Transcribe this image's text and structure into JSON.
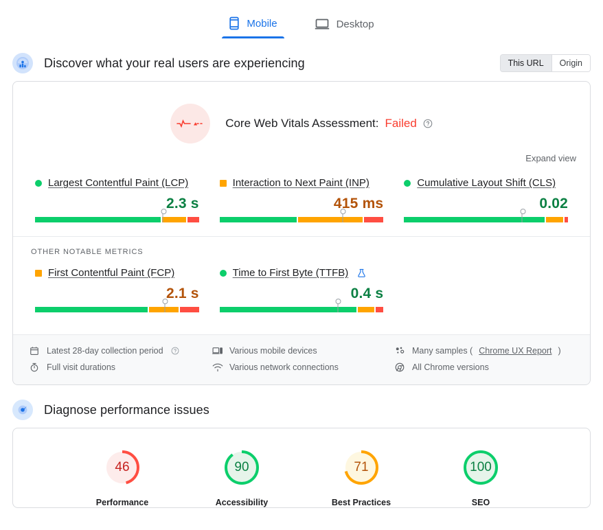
{
  "device_tabs": [
    {
      "id": "mobile",
      "label": "Mobile",
      "icon": "phone-icon",
      "active": true
    },
    {
      "id": "desktop",
      "label": "Desktop",
      "icon": "laptop-icon",
      "active": false
    }
  ],
  "field_section": {
    "title": "Discover what your real users are experiencing",
    "icon": "users-chart-icon",
    "scope_toggle": {
      "options": [
        {
          "id": "this-url",
          "label": "This URL",
          "selected": true
        },
        {
          "id": "origin",
          "label": "Origin",
          "selected": false
        }
      ]
    },
    "assessment": {
      "icon": "pulse-icon",
      "label": "Core Web Vitals Assessment:",
      "status": "Failed",
      "status_color": "#f93c2e",
      "help_icon": "help-circle-icon"
    },
    "expand_view": "Expand view",
    "other_metrics_label": "OTHER NOTABLE METRICS",
    "core_metrics": [
      {
        "id": "lcp",
        "name": "Largest Contentful Paint (LCP)",
        "rating": "good",
        "value": "2.3 s",
        "distribution": {
          "good": 78,
          "needs_improvement": 15,
          "poor": 7
        },
        "marker_percent": 78
      },
      {
        "id": "inp",
        "name": "Interaction to Next Paint (INP)",
        "rating": "average",
        "value": "415 ms",
        "distribution": {
          "good": 48,
          "needs_improvement": 40,
          "poor": 12
        },
        "marker_percent": 75
      },
      {
        "id": "cls",
        "name": "Cumulative Layout Shift (CLS)",
        "rating": "good",
        "value": "0.02",
        "distribution": {
          "good": 87,
          "needs_improvement": 11,
          "poor": 2
        },
        "marker_percent": 72
      }
    ],
    "other_notable_metrics": [
      {
        "id": "fcp",
        "name": "First Contentful Paint (FCP)",
        "rating": "average",
        "value": "2.1 s",
        "distribution": {
          "good": 70,
          "needs_improvement": 18,
          "poor": 12
        },
        "marker_percent": 79,
        "experimental": false
      },
      {
        "id": "ttfb",
        "name": "Time to First Byte (TTFB)",
        "rating": "good",
        "value": "0.4 s",
        "distribution": {
          "good": 85,
          "needs_improvement": 10,
          "poor": 5
        },
        "marker_percent": 72,
        "experimental": true,
        "experimental_icon": "flask-icon"
      }
    ],
    "meta_items": [
      {
        "id": "collection-period",
        "icon": "calendar-icon",
        "text": "Latest 28-day collection period",
        "help": true
      },
      {
        "id": "mobile-devices",
        "icon": "devices-icon",
        "text": "Various mobile devices",
        "help": false
      },
      {
        "id": "many-samples",
        "icon": "samples-icon",
        "text": "Many samples (",
        "link": "Chrome UX Report",
        "text_after": ")",
        "help": false
      },
      {
        "id": "visit-durations",
        "icon": "stopwatch-icon",
        "text": "Full visit durations",
        "help": false
      },
      {
        "id": "network-connections",
        "icon": "wifi-icon",
        "text": "Various network connections",
        "help": false
      },
      {
        "id": "chrome-versions",
        "icon": "chrome-icon",
        "text": "All Chrome versions",
        "help": false
      }
    ]
  },
  "lab_section": {
    "title": "Diagnose performance issues",
    "icon": "target-icon",
    "scores": [
      {
        "id": "performance",
        "label": "Performance",
        "value": 46,
        "rating": "poor",
        "color": "#ff4e42",
        "bg": "#fdeceb",
        "text_color": "#c5221f"
      },
      {
        "id": "accessibility",
        "label": "Accessibility",
        "value": 90,
        "rating": "good",
        "color": "#0cce6b",
        "bg": "#e6f4ea",
        "text_color": "#0b8043"
      },
      {
        "id": "best-practices",
        "label": "Best Practices",
        "value": 71,
        "rating": "average",
        "color": "#ffa400",
        "bg": "#fef7e0",
        "text_color": "#b35309"
      },
      {
        "id": "seo",
        "label": "SEO",
        "value": 100,
        "rating": "good",
        "color": "#0cce6b",
        "bg": "#e6f4ea",
        "text_color": "#0b8043"
      }
    ]
  }
}
